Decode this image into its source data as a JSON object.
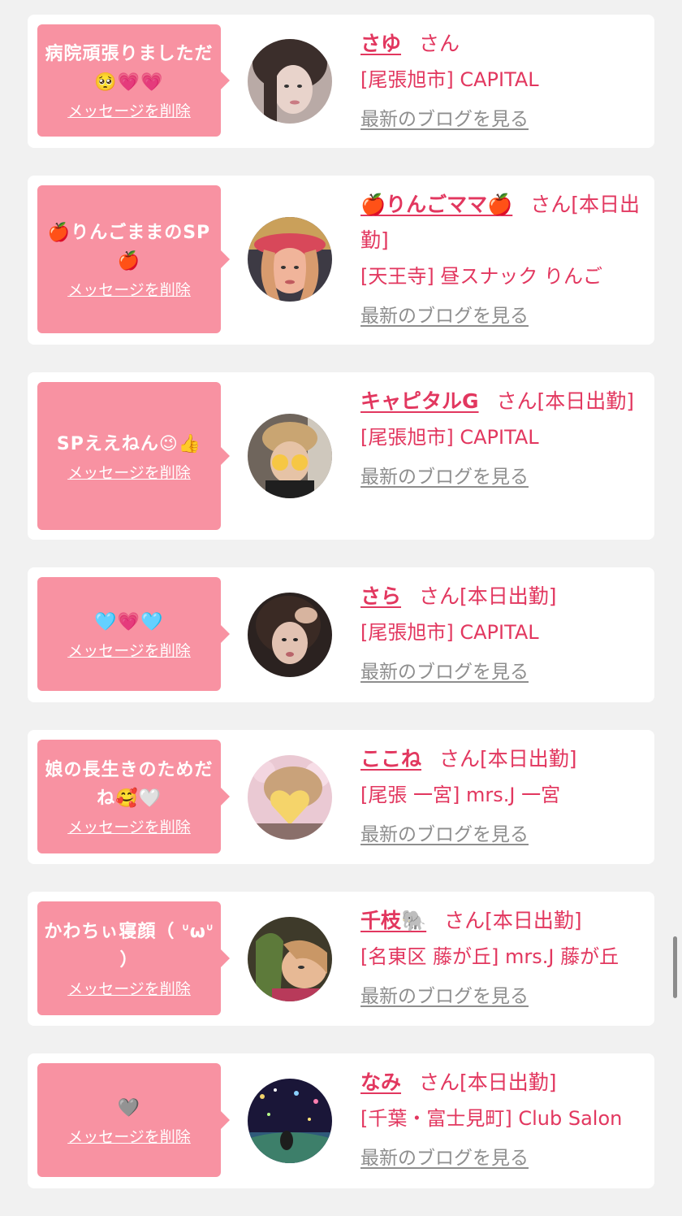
{
  "common": {
    "delete_label": "メッセージを削除",
    "blog_label": "最新のブログを見る"
  },
  "items": [
    {
      "message": "病院頑張りましただ🥺💗💗",
      "name": "さゆ",
      "suffix": "さん",
      "shop": "[尾張旭市] CAPITAL",
      "avatar_icon": "avatar-photo"
    },
    {
      "message": "🍎りんごままのSP🍎",
      "name": "🍎りんごママ🍎",
      "suffix": "さん[本日出勤]",
      "shop": "[天王寺] 昼スナック りんご",
      "avatar_icon": "avatar-photo"
    },
    {
      "message": "SPええねん😉👍",
      "name": "キャピタルG",
      "suffix": "さん[本日出勤]",
      "shop": "[尾張旭市] CAPITAL",
      "avatar_icon": "avatar-photo"
    },
    {
      "message": "🩵💗🩵",
      "name": "さら",
      "suffix": "さん[本日出勤]",
      "shop": "[尾張旭市] CAPITAL",
      "avatar_icon": "avatar-photo"
    },
    {
      "message": "娘の長生きのためだね🥰🤍",
      "name": "ここね",
      "suffix": "さん[本日出勤]",
      "shop": "[尾張 一宮] mrs.J 一宮",
      "avatar_icon": "avatar-photo"
    },
    {
      "message": "かわちぃ寝顔（ ᐡωᐡ ）",
      "name": "千枝🐘",
      "suffix": "さん[本日出勤]",
      "shop": "[名東区 藤が丘] mrs.J 藤が丘",
      "avatar_icon": "avatar-photo"
    },
    {
      "message": "🩶",
      "name": "なみ",
      "suffix": "さん[本日出勤]",
      "shop": "[千葉・富士見町] Club Salon",
      "avatar_icon": "avatar-photo"
    }
  ],
  "colors": {
    "accent": "#e2375f",
    "bubble": "#f892a2",
    "link_gray": "#8e8e8e",
    "background": "#f1f1f1"
  }
}
